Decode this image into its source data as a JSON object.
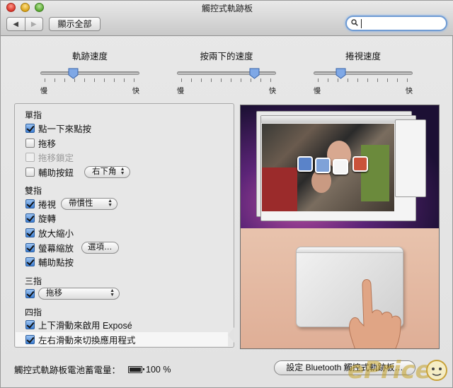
{
  "window": {
    "title": "觸控式軌跡板"
  },
  "toolbar": {
    "back_icon": "◀",
    "forward_icon": "▶",
    "show_all_label": "顯示全部",
    "search_placeholder": ""
  },
  "sliders": [
    {
      "title": "軌跡速度",
      "min_label": "慢",
      "max_label": "快",
      "level": 0.31
    },
    {
      "title": "按兩下的速度",
      "min_label": "慢",
      "max_label": "快",
      "level": 0.82
    },
    {
      "title": "捲視速度",
      "min_label": "慢",
      "max_label": "快",
      "level": 0.24
    }
  ],
  "sections": {
    "one_finger": {
      "heading": "單指",
      "items": [
        {
          "label": "點一下來點按",
          "checked": true
        },
        {
          "label": "拖移",
          "checked": false
        },
        {
          "label": "拖移鎖定",
          "checked": false,
          "disabled": true
        },
        {
          "label": "輔助按鈕",
          "checked": false,
          "popup": "右下角"
        }
      ]
    },
    "two_fingers": {
      "heading": "雙指",
      "items": [
        {
          "label": "捲視",
          "checked": true,
          "popup": "帶慣性"
        },
        {
          "label": "旋轉",
          "checked": true
        },
        {
          "label": "放大縮小",
          "checked": true
        },
        {
          "label": "螢幕縮放",
          "checked": true,
          "button": "選項…"
        },
        {
          "label": "輔助點按",
          "checked": true
        }
      ]
    },
    "three_fingers": {
      "heading": "三指",
      "items": [
        {
          "label": "",
          "checked": true,
          "popup": "拖移"
        }
      ]
    },
    "four_fingers": {
      "heading": "四指",
      "items": [
        {
          "label": "上下滑動來啟用 Exposé",
          "checked": true
        },
        {
          "label": "左右滑動來切換應用程式",
          "checked": true,
          "selected": true
        }
      ]
    }
  },
  "battery": {
    "label": "觸控式軌跡板電池蓄電量：",
    "value": "100 %",
    "level": 1.0
  },
  "bluetooth_button": "設定 Bluetooth 觸控式軌跡板…",
  "watermark": "ePrice",
  "colors": {
    "accent": "#3e7fd4",
    "focus_ring": "#6f9bd3"
  }
}
